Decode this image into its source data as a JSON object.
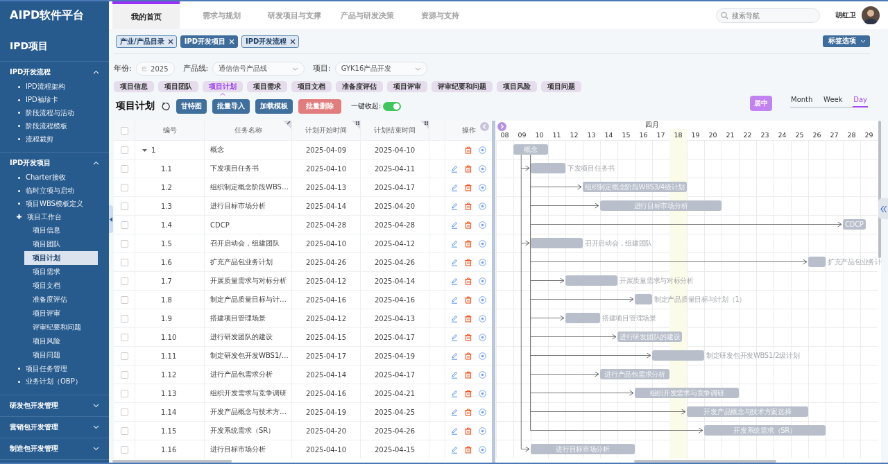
{
  "sidebar": {
    "app_title": "AIPD软件平台",
    "module_title": "IPD项目",
    "sections": [
      {
        "label": "IPD开发流程",
        "expanded": true,
        "items": [
          {
            "label": "IPD流程架构",
            "selected": false
          },
          {
            "label": "IPD袖珍卡",
            "selected": false
          },
          {
            "label": "阶段流程与活动",
            "selected": false
          },
          {
            "label": "阶段流程模板",
            "selected": false
          },
          {
            "label": "流程裁剪",
            "selected": false
          }
        ]
      },
      {
        "label": "IPD开发项目",
        "expanded": true,
        "items": [
          {
            "label": "Charter接收",
            "selected": false
          },
          {
            "label": "临时立项与启动",
            "selected": false
          },
          {
            "label": "项目WBS模板定义",
            "selected": false
          },
          {
            "label": "项目工作台",
            "selected": false,
            "expanded": true,
            "children": [
              {
                "label": "项目信息",
                "selected": false
              },
              {
                "label": "项目团队",
                "selected": false
              },
              {
                "label": "项目计划",
                "selected": true
              },
              {
                "label": "项目需求",
                "selected": false
              },
              {
                "label": "项目文档",
                "selected": false
              },
              {
                "label": "准备度评估",
                "selected": false
              },
              {
                "label": "项目评审",
                "selected": false
              },
              {
                "label": "评审纪要和问题",
                "selected": false
              },
              {
                "label": "项目风险",
                "selected": false
              },
              {
                "label": "项目问题",
                "selected": false
              }
            ]
          },
          {
            "label": "项目任务管理",
            "selected": false
          },
          {
            "label": "业务计划（OBP）",
            "selected": false
          }
        ]
      },
      {
        "label": "研发包开发管理",
        "expanded": false
      },
      {
        "label": "营销包开发管理",
        "expanded": false
      },
      {
        "label": "制造包开发管理",
        "expanded": false
      }
    ]
  },
  "top_nav": {
    "tabs": [
      {
        "label": "我的首页",
        "selected": true
      },
      {
        "label": "需求与规划",
        "selected": false
      },
      {
        "label": "研发项目与支撑",
        "selected": false
      },
      {
        "label": "产品与研发决策",
        "selected": false
      },
      {
        "label": "资源与支持",
        "selected": false
      }
    ],
    "search": {
      "placeholder": "搜索导航"
    },
    "user": {
      "name": "胡红卫"
    }
  },
  "open_tags": [
    {
      "label": "产业/产品目录",
      "selected": false
    },
    {
      "label": "IPD开发项目",
      "selected": true
    },
    {
      "label": "IPD开发流程",
      "selected": false
    }
  ],
  "tag_options_button": "标签选项",
  "filters": [
    {
      "label": "年份:",
      "value": "2025",
      "kind": "date"
    },
    {
      "label": "产品线:",
      "value": "通信信号产品线",
      "kind": "select"
    },
    {
      "label": "项目:",
      "value": "GYK16产品开发",
      "kind": "select"
    }
  ],
  "section_tabs": [
    {
      "label": "项目信息",
      "selected": false
    },
    {
      "label": "项目团队",
      "selected": false
    },
    {
      "label": "项目计划",
      "selected": true
    },
    {
      "label": "项目需求",
      "selected": false
    },
    {
      "label": "项目文档",
      "selected": false
    },
    {
      "label": "准备度评估",
      "selected": false
    },
    {
      "label": "项目评审",
      "selected": false
    },
    {
      "label": "评审纪要和问题",
      "selected": false
    },
    {
      "label": "项目风险",
      "selected": false
    },
    {
      "label": "项目问题",
      "selected": false
    }
  ],
  "toolbar": {
    "title": "项目计划",
    "buttons": [
      {
        "label": "甘特图",
        "kind": "primary"
      },
      {
        "label": "批量导入",
        "kind": "primary"
      },
      {
        "label": "加载模板",
        "kind": "primary"
      },
      {
        "label": "批量删除",
        "kind": "danger"
      }
    ],
    "collapse_all": {
      "label": "一键收起:",
      "on": true
    }
  },
  "gantt_controls": {
    "center_button": "居中",
    "scales": [
      {
        "label": "Month",
        "selected": false
      },
      {
        "label": "Week",
        "selected": false
      },
      {
        "label": "Day",
        "selected": true
      }
    ]
  },
  "table": {
    "select_all_checked": false,
    "columns": [
      {
        "label": "编号",
        "kind": "plain"
      },
      {
        "label": "任务名称",
        "kind": "edit"
      },
      {
        "label": "计划开始时间",
        "kind": "grid"
      },
      {
        "label": "计划结束时间",
        "kind": "grid"
      },
      {
        "label": "操作",
        "kind": "plain"
      }
    ],
    "rows": [
      {
        "number": "1",
        "name": "概念",
        "start": "2025-04-09",
        "end": "2025-04-10",
        "kind": "group",
        "expanded": true,
        "checked": false,
        "bar_label": "概念",
        "label_inside": true
      },
      {
        "number": "1.1",
        "name": "下发项目任务书",
        "start": "2025-04-10",
        "end": "2025-04-11",
        "kind": "task",
        "checked": false,
        "bar_label": "下发项目任务书",
        "label_inside": false
      },
      {
        "number": "1.2",
        "name": "组织制定概念阶段WBS…",
        "start": "2025-04-13",
        "end": "2025-04-17",
        "kind": "task",
        "checked": false,
        "bar_label": "组织制定概念阶段WBS3/4级计划",
        "label_inside": true
      },
      {
        "number": "1.3",
        "name": "进行目标市场分析",
        "start": "2025-04-14",
        "end": "2025-04-20",
        "kind": "task",
        "checked": false,
        "bar_label": "进行目标市场分析",
        "label_inside": true
      },
      {
        "number": "1.4",
        "name": "CDCP",
        "start": "2025-04-28",
        "end": "2025-04-28",
        "kind": "task",
        "checked": false,
        "bar_label": "CDCP",
        "label_inside": true
      },
      {
        "number": "1.5",
        "name": "召开启动会，组建团队",
        "start": "2025-04-10",
        "end": "2025-04-12",
        "kind": "task",
        "checked": false,
        "bar_label": "召开启动会，组建团队",
        "label_inside": false
      },
      {
        "number": "1.6",
        "name": "扩充产品包业务计划",
        "start": "2025-04-26",
        "end": "2025-04-26",
        "kind": "task",
        "checked": false,
        "bar_label": "扩充产品包业务计",
        "label_inside": false
      },
      {
        "number": "1.7",
        "name": "开展质量需求与对标分析",
        "start": "2025-04-12",
        "end": "2025-04-14",
        "kind": "task",
        "checked": false,
        "bar_label": "开展质量需求与对标分析",
        "label_inside": false
      },
      {
        "number": "1.8",
        "name": "制定产品质量目标与计…",
        "start": "2025-04-16",
        "end": "2025-04-16",
        "kind": "task",
        "checked": false,
        "bar_label": "制定产品质量目标与计划（1）",
        "label_inside": false
      },
      {
        "number": "1.9",
        "name": "搭建项目管理场景",
        "start": "2025-04-12",
        "end": "2025-04-13",
        "kind": "task",
        "checked": false,
        "bar_label": "搭建项目管理场景",
        "label_inside": false
      },
      {
        "number": "1.10",
        "name": "进行研发团队的建设",
        "start": "2025-04-15",
        "end": "2025-04-17",
        "kind": "task",
        "checked": false,
        "bar_label": "进行研发团队的建设",
        "label_inside": true
      },
      {
        "number": "1.11",
        "name": "制定研发包开发WBS1/…",
        "start": "2025-04-17",
        "end": "2025-04-19",
        "kind": "task",
        "checked": false,
        "bar_label": "制定研发包开发WBS1/2级计划",
        "label_inside": false
      },
      {
        "number": "1.12",
        "name": "进行产品包需求分析",
        "start": "2025-04-14",
        "end": "2025-04-17",
        "kind": "task",
        "checked": false,
        "bar_label": "进行产品包需求分析",
        "label_inside": true
      },
      {
        "number": "1.13",
        "name": "组织开发需求与竞争调研",
        "start": "2025-04-16",
        "end": "2025-04-21",
        "kind": "task",
        "checked": false,
        "bar_label": "组织开发需求与竞争调研",
        "label_inside": true
      },
      {
        "number": "1.14",
        "name": "开发产品概念与技术方…",
        "start": "2025-04-19",
        "end": "2025-04-25",
        "kind": "task",
        "checked": false,
        "bar_label": "开发产品概念与技术方案选择",
        "label_inside": true
      },
      {
        "number": "1.15",
        "name": "开发系统需求（SR）",
        "start": "2025-04-20",
        "end": "2025-04-26",
        "kind": "task",
        "checked": false,
        "bar_label": "开发系统需求（SR）",
        "label_inside": true
      },
      {
        "number": "1.16",
        "name": "进行目标市场分析",
        "start": "2025-04-10",
        "end": "2025-04-15",
        "kind": "task",
        "checked": false,
        "bar_label": "进行目标市场分析",
        "label_inside": true
      }
    ]
  },
  "gantt": {
    "month": "四月",
    "days": [
      {
        "label": "08",
        "highlighted": false
      },
      {
        "label": "09",
        "highlighted": false
      },
      {
        "label": "10",
        "highlighted": false
      },
      {
        "label": "11",
        "highlighted": false
      },
      {
        "label": "12",
        "highlighted": false
      },
      {
        "label": "13",
        "highlighted": false
      },
      {
        "label": "14",
        "highlighted": false
      },
      {
        "label": "15",
        "highlighted": false
      },
      {
        "label": "16",
        "highlighted": false
      },
      {
        "label": "17",
        "highlighted": false
      },
      {
        "label": "18",
        "highlighted": true
      },
      {
        "label": "19",
        "highlighted": false
      },
      {
        "label": "20",
        "highlighted": false
      },
      {
        "label": "21",
        "highlighted": false
      },
      {
        "label": "22",
        "highlighted": false
      },
      {
        "label": "23",
        "highlighted": false
      },
      {
        "label": "24",
        "highlighted": false
      },
      {
        "label": "25",
        "highlighted": false
      },
      {
        "label": "26",
        "highlighted": false
      },
      {
        "label": "27",
        "highlighted": false
      },
      {
        "label": "28",
        "highlighted": false
      },
      {
        "label": "29",
        "highlighted": false
      }
    ]
  }
}
